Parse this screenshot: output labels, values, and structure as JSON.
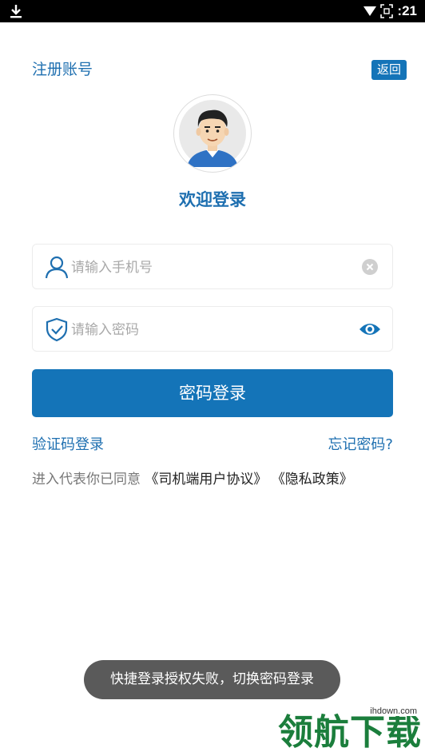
{
  "status_bar": {
    "time": ":21",
    "download_icon": "download-icon",
    "wifi_icon": "wifi-icon",
    "screenshot_icon": "screenshot-icon"
  },
  "header": {
    "register_label": "注册账号",
    "back_label": "返回"
  },
  "welcome": {
    "title": "欢迎登录"
  },
  "phone_field": {
    "placeholder": "请输入手机号",
    "value": "",
    "icon": "user-icon",
    "clear_icon": "clear-icon"
  },
  "password_field": {
    "placeholder": "请输入密码",
    "value": "",
    "icon": "shield-check-icon",
    "toggle_icon": "eye-icon"
  },
  "login_button": {
    "label": "密码登录"
  },
  "links": {
    "code_login": "验证码登录",
    "forgot_password": "忘记密码?"
  },
  "agreement": {
    "prefix": "进入代表你已同意",
    "driver_agreement": "《司机端用户协议》",
    "privacy_policy": "《隐私政策》"
  },
  "toast": {
    "message": "快捷登录授权失败，切换密码登录"
  },
  "watermark": {
    "text": "领航下载",
    "url": "ihdown.com"
  },
  "colors": {
    "primary": "#1474b8",
    "link": "#1e6fb0",
    "toast_bg": "#5a5a5a"
  }
}
